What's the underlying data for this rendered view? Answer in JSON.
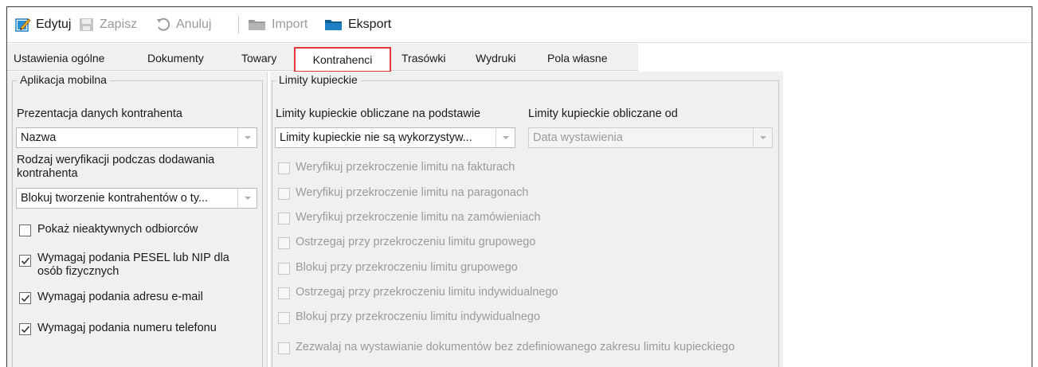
{
  "toolbar": {
    "edit": "Edytuj",
    "save": "Zapisz",
    "cancel": "Anuluj",
    "import": "Import",
    "export": "Eksport"
  },
  "tabs": [
    {
      "label": "Ustawienia ogólne"
    },
    {
      "label": "Dokumenty"
    },
    {
      "label": "Towary"
    },
    {
      "label": "Kontrahenci"
    },
    {
      "label": "Trasówki"
    },
    {
      "label": "Wydruki"
    },
    {
      "label": "Pola własne"
    }
  ],
  "mobile": {
    "title": "Aplikacja mobilna",
    "presentation_label": "Prezentacja danych kontrahenta",
    "presentation_value": "Nazwa",
    "verification_label_1": "Rodzaj weryfikacji podczas dodawania",
    "verification_label_2": "kontrahenta",
    "verification_value": "Blokuj tworzenie kontrahentów o ty...",
    "checkboxes": [
      {
        "label": "Pokaż nieaktywnych odbiorców",
        "checked": false
      },
      {
        "label": "Wymagaj podania PESEL lub NIP dla",
        "label2": "osób fizycznych",
        "checked": true
      },
      {
        "label": "Wymagaj podania adresu e-mail",
        "checked": true
      },
      {
        "label": "Wymagaj podania numeru telefonu",
        "checked": true
      }
    ]
  },
  "limits": {
    "title": "Limity kupieckie",
    "basis_label": "Limity kupieckie obliczane na podstawie",
    "basis_value": "Limity kupieckie nie są wykorzystyw...",
    "from_label": "Limity kupieckie obliczane od",
    "from_value": "Data wystawienia",
    "checkboxes": [
      {
        "label": "Weryfikuj przekroczenie limitu na fakturach",
        "checked": false
      },
      {
        "label": "Weryfikuj przekroczenie limitu na paragonach",
        "checked": false
      },
      {
        "label": "Weryfikuj przekroczenie limitu na zamówieniach",
        "checked": false
      },
      {
        "label": "Ostrzegaj przy przekroczeniu limitu grupowego",
        "checked": false
      },
      {
        "label": "Blokuj przy przekroczeniu limitu grupowego",
        "checked": false
      },
      {
        "label": "Ostrzegaj przy przekroczeniu limitu indywidualnego",
        "checked": false
      },
      {
        "label": "Blokuj przy przekroczeniu limitu indywidualnego",
        "checked": false
      },
      {
        "label": "Zezwalaj na wystawianie dokumentów bez zdefiniowanego zakresu limitu kupieckiego",
        "checked": false
      }
    ]
  },
  "colors": {
    "accent_blue": "#1f7fc4",
    "active_tab_border": "#e03a3a",
    "disabled_text": "#9a9a9a"
  }
}
